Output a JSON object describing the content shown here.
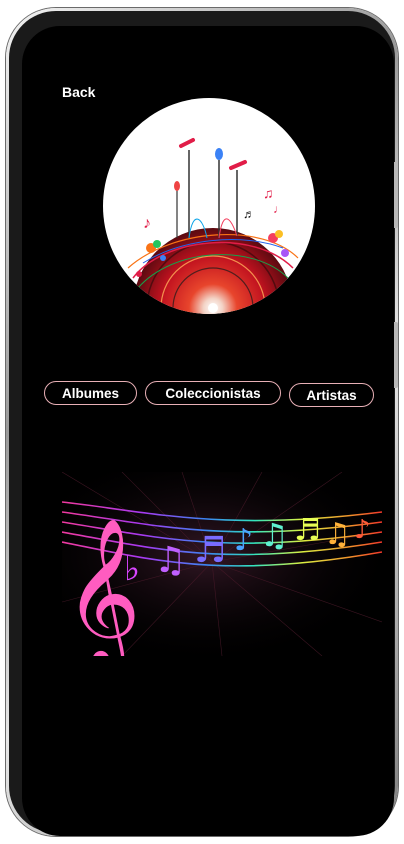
{
  "nav": {
    "back_label": "Back"
  },
  "tabs": [
    {
      "label": "Albumes"
    },
    {
      "label": "Coleccionistas"
    },
    {
      "label": "Artistas"
    }
  ],
  "icons": {
    "hero": "music-record-microphones-illustration",
    "banner": "rainbow-music-notes-banner"
  },
  "colors": {
    "screen_bg": "#000000",
    "tab_border": "#e8b0b6",
    "text": "#ffffff"
  }
}
